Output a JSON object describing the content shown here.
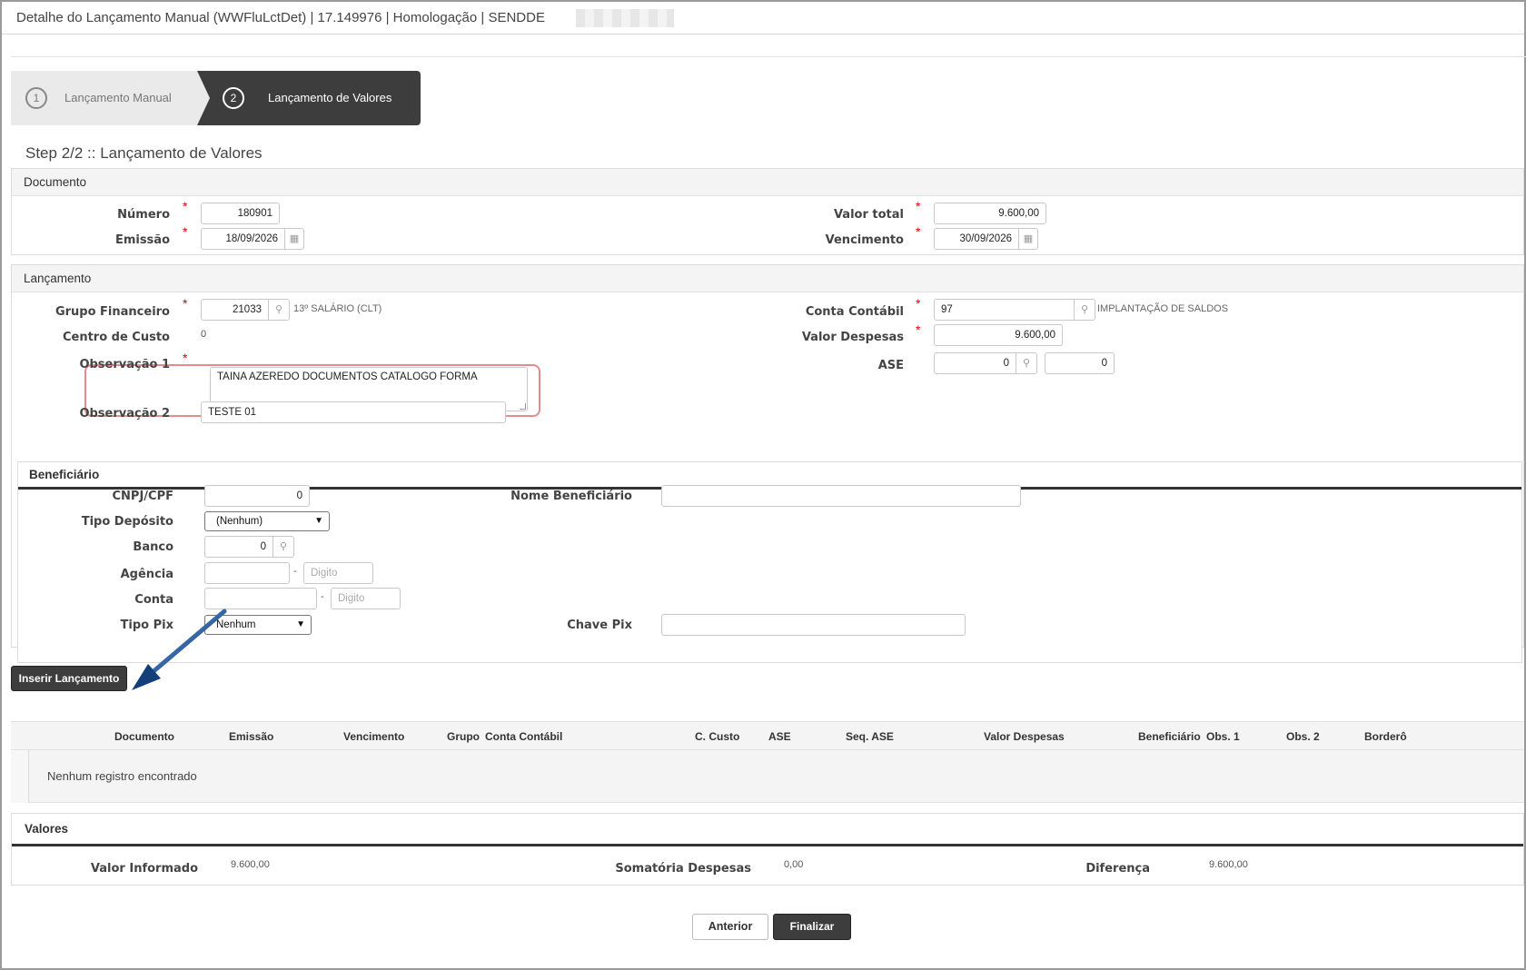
{
  "window": {
    "title": "Detalhe do Lançamento Manual (WWFluLctDet) | 17.149976 | Homologação | SENDDE"
  },
  "wizard": {
    "steps": [
      {
        "num": "1",
        "label": "Lançamento Manual"
      },
      {
        "num": "2",
        "label": "Lançamento de Valores"
      }
    ]
  },
  "page_heading": "Step 2/2 :: Lançamento de Valores",
  "documento": {
    "section_title": "Documento",
    "numero_label": "Número",
    "numero_value": "180901",
    "emissao_label": "Emissão",
    "emissao_value": "18/09/2026",
    "valor_total_label": "Valor total",
    "valor_total_value": "9.600,00",
    "vencimento_label": "Vencimento",
    "vencimento_value": "30/09/2026"
  },
  "lancamento": {
    "section_title": "Lançamento",
    "grupo_label": "Grupo Financeiro",
    "grupo_value": "21033",
    "grupo_desc": "13º SALÁRIO (CLT)",
    "centro_label": "Centro de Custo",
    "centro_value": "0",
    "obs1_label": "Observação 1",
    "obs1_value": "TAINA AZEREDO  DOCUMENTOS CATALOGO FORMA",
    "obs2_label": "Observação 2",
    "obs2_value": "TESTE 01",
    "conta_label": "Conta Contábil",
    "conta_value": "97",
    "conta_desc": "IMPLANTAÇÃO DE SALDOS",
    "valor_desp_label": "Valor Despesas",
    "valor_desp_value": "9.600,00",
    "ase_label": "ASE",
    "ase_value": "0",
    "ase_seq_value": "0"
  },
  "beneficiario": {
    "section_title": "Beneficiário",
    "cnpj_label": "CNPJ/CPF",
    "cnpj_value": "0",
    "tipo_dep_label": "Tipo Depósito",
    "tipo_dep_value": "(Nenhum)",
    "banco_label": "Banco",
    "banco_value": "0",
    "agencia_label": "Agência",
    "agencia_digito_placeholder": "Digito",
    "conta_label": "Conta",
    "conta_digito_placeholder": "Digito",
    "dash": "-",
    "tipo_pix_label": "Tipo Pix",
    "tipo_pix_value": "Nenhum",
    "nome_label": "Nome Beneficiário",
    "chave_pix_label": "Chave Pix"
  },
  "actions": {
    "inserir": "Inserir Lançamento",
    "anterior": "Anterior",
    "finalizar": "Finalizar"
  },
  "grid": {
    "columns": [
      "Documento",
      "Emissão",
      "Vencimento",
      "Grupo",
      "Conta Contábil",
      "C. Custo",
      "ASE",
      "Seq. ASE",
      "Valor Despesas",
      "Beneficiário",
      "Obs. 1",
      "Obs. 2",
      "Borderô"
    ],
    "empty_message": "Nenhum registro encontrado"
  },
  "valores": {
    "section_title": "Valores",
    "informado_label": "Valor Informado",
    "informado_value": "9.600,00",
    "somatoria_label": "Somatória Despesas",
    "somatoria_value": "0,00",
    "diferenca_label": "Diferença",
    "diferenca_value": "9.600,00"
  },
  "icons": {
    "search": "search-icon",
    "calendar": "calendar-icon",
    "select_chevron": "chevron-down-icon"
  },
  "colors": {
    "highlight": "#e58b8b",
    "annotation_arrow": "#1f4f8f",
    "dark_button": "#3d3d3d",
    "required": "#dd0000"
  }
}
